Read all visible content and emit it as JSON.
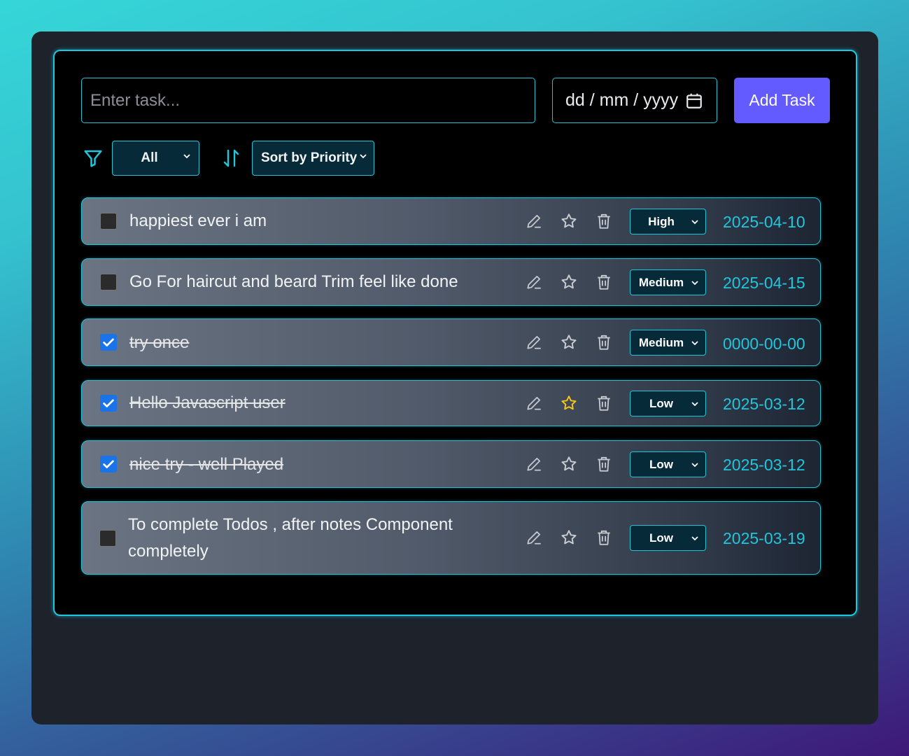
{
  "form": {
    "task_placeholder": "Enter task...",
    "date_placeholder": "dd / mm / yyyy",
    "add_button": "Add Task"
  },
  "controls": {
    "filter_value": "All",
    "sort_value": "Sort by Priority"
  },
  "colors": {
    "accent": "#1fc7dc",
    "button": "#635bff",
    "star_active": "#f5c518"
  },
  "tasks": [
    {
      "text": "happiest ever i am",
      "done": false,
      "starred": false,
      "priority": "High",
      "date": "2025-04-10"
    },
    {
      "text": "Go For haircut and beard Trim feel like done",
      "done": false,
      "starred": false,
      "priority": "Medium",
      "date": "2025-04-15"
    },
    {
      "text": "try once",
      "done": true,
      "starred": false,
      "priority": "Medium",
      "date": "0000-00-00"
    },
    {
      "text": "Hello Javascript user",
      "done": true,
      "starred": true,
      "priority": "Low",
      "date": "2025-03-12"
    },
    {
      "text": "nice try - well Played",
      "done": true,
      "starred": false,
      "priority": "Low",
      "date": "2025-03-12"
    },
    {
      "text": "To complete Todos , after notes Component completely",
      "done": false,
      "starred": false,
      "priority": "Low",
      "date": "2025-03-19"
    }
  ]
}
